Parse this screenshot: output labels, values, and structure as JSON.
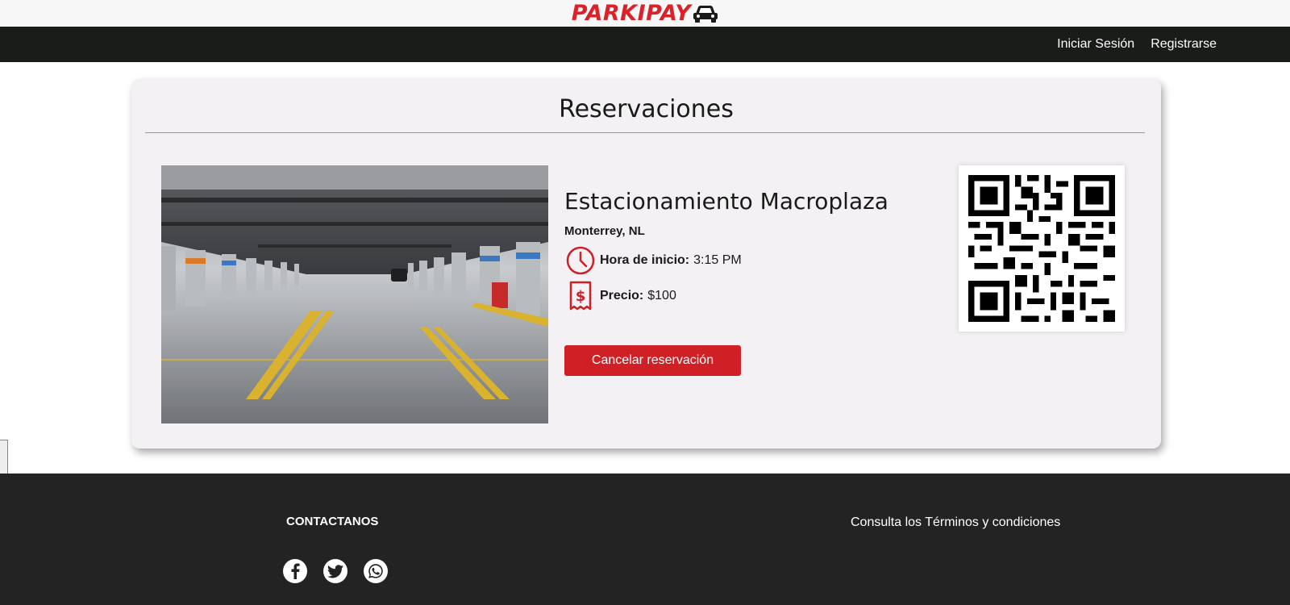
{
  "brand": {
    "name": "PARKIPAY",
    "color": "#d9222a"
  },
  "nav": {
    "login": "Iniciar Sesión",
    "register": "Registrarse"
  },
  "page": {
    "title": "Reservaciones"
  },
  "reservation": {
    "lot_name": "Estacionamiento Macroplaza",
    "city": "Monterrey, NL",
    "start_label": "Hora de inicio:",
    "start_time": "3:15 PM",
    "price_label": "Precio:",
    "price_value": "$100",
    "cancel_label": "Cancelar reservación"
  },
  "footer": {
    "contact_title": "CONTACTANOS",
    "terms": "Consulta los Términos y condiciones",
    "social_icons": [
      "facebook-icon",
      "twitter-icon",
      "whatsapp-icon"
    ]
  },
  "colors": {
    "accent": "#cf2026",
    "nav_bg": "#1a1c1a",
    "footer_bg": "#222322",
    "card_bg": "#f3f1f3"
  }
}
